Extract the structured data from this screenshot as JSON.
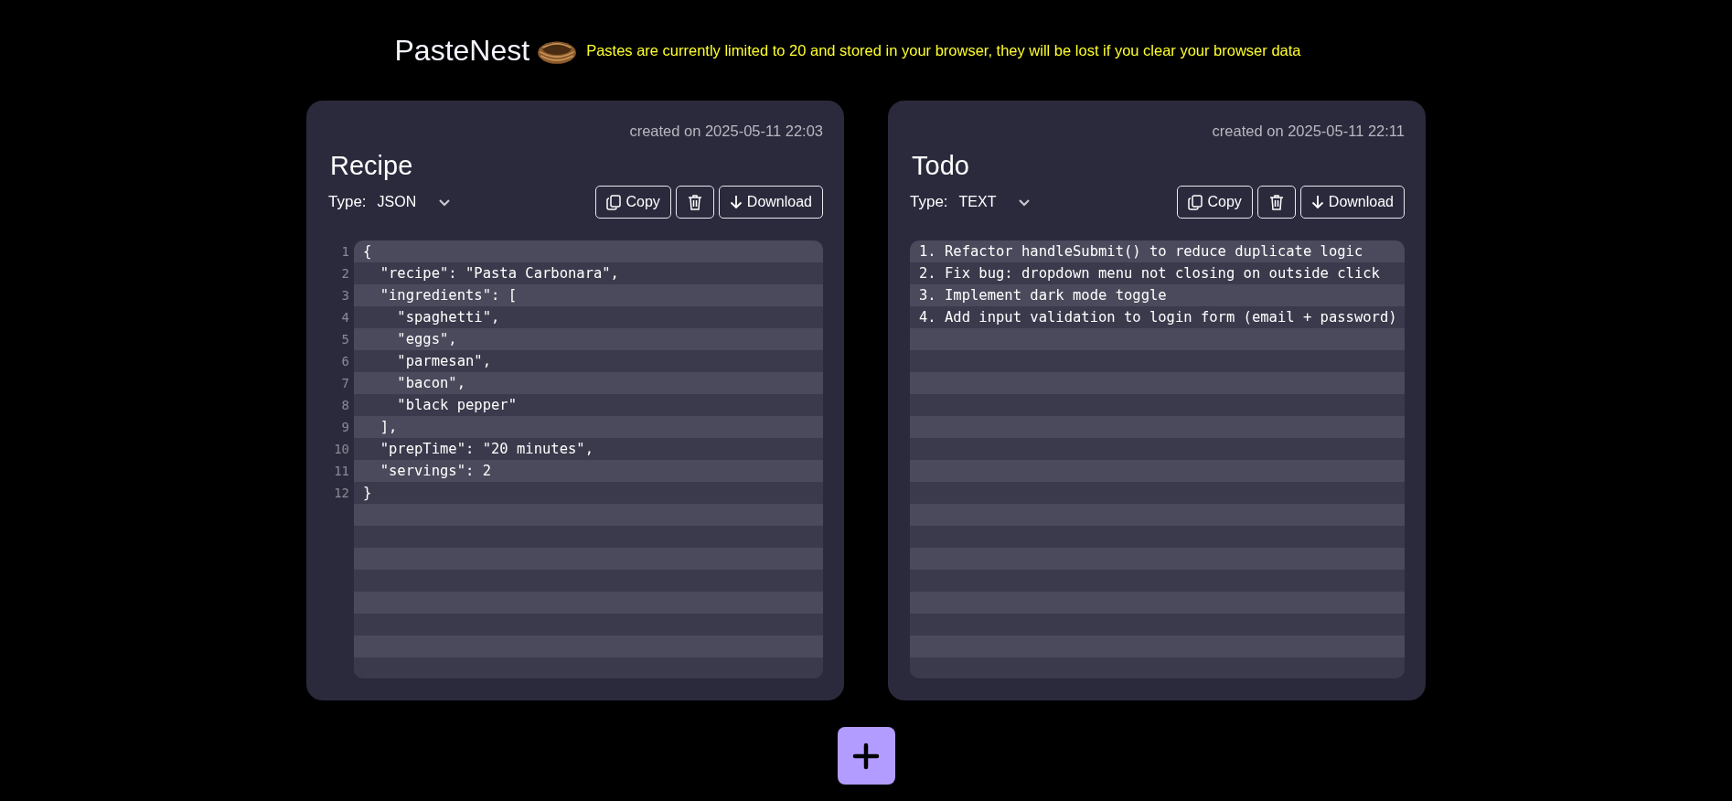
{
  "header": {
    "title": "PasteNest",
    "notice": "Pastes are currently limited to 20 and stored in your browser, they will be lost if you clear your browser data"
  },
  "pastes": [
    {
      "created": "created on 2025-05-11 22:03",
      "title": "Recipe",
      "type_label": "Type:",
      "type": "JSON",
      "kind": "code",
      "buttons": {
        "copy": "Copy",
        "download": "Download"
      },
      "lines": [
        {
          "n": "1",
          "text": "{"
        },
        {
          "n": "2",
          "text": "  \"recipe\": \"Pasta Carbonara\","
        },
        {
          "n": "3",
          "text": "  \"ingredients\": ["
        },
        {
          "n": "4",
          "text": "    \"spaghetti\","
        },
        {
          "n": "5",
          "text": "    \"eggs\","
        },
        {
          "n": "6",
          "text": "    \"parmesan\","
        },
        {
          "n": "7",
          "text": "    \"bacon\","
        },
        {
          "n": "8",
          "text": "    \"black pepper\""
        },
        {
          "n": "9",
          "text": "  ],"
        },
        {
          "n": "10",
          "text": "  \"prepTime\": \"20 minutes\","
        },
        {
          "n": "11",
          "text": "  \"servings\": 2"
        },
        {
          "n": "12",
          "text": "}"
        }
      ]
    },
    {
      "created": "created on 2025-05-11 22:11",
      "title": "Todo",
      "type_label": "Type:",
      "type": "TEXT",
      "kind": "text",
      "buttons": {
        "copy": "Copy",
        "download": "Download"
      },
      "lines": [
        {
          "text": "1. Refactor handleSubmit() to reduce duplicate logic"
        },
        {
          "text": "2. Fix bug: dropdown menu not closing on outside click"
        },
        {
          "text": "3. Implement dark mode toggle"
        },
        {
          "text": "4. Add input validation to login form (email + password)"
        }
      ]
    }
  ]
}
